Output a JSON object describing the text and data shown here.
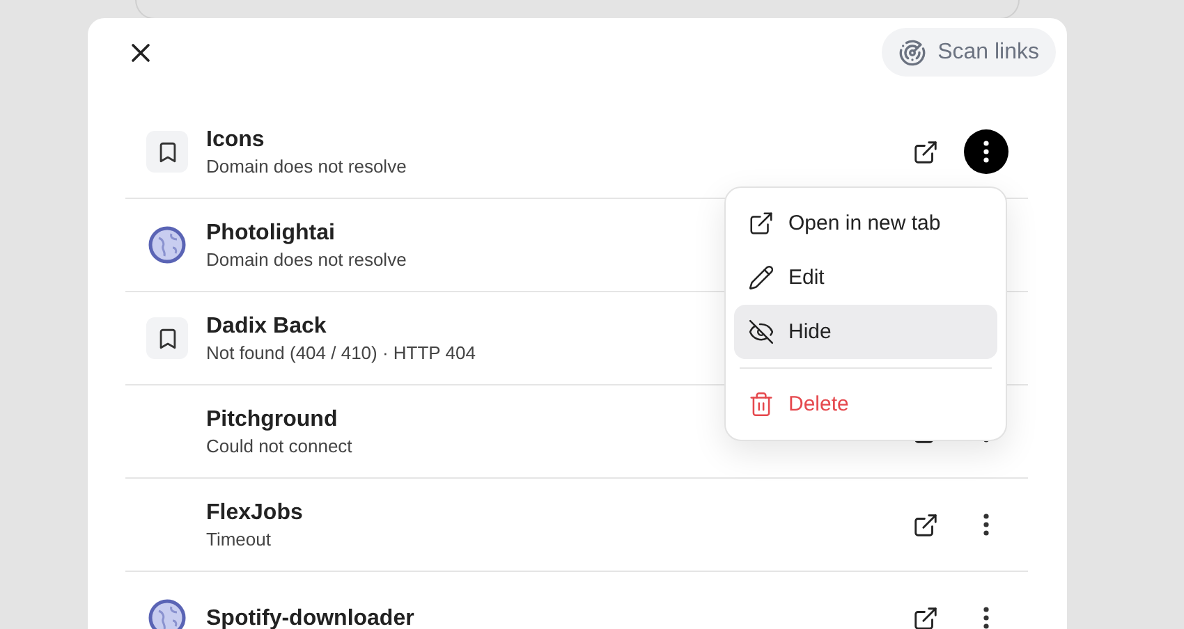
{
  "header": {
    "scan_button": "Scan links"
  },
  "links": [
    {
      "title": "Icons",
      "status": "Domain does not resolve",
      "kind": "bookmark",
      "menu_open": true
    },
    {
      "title": "Photolightai",
      "status": "Domain does not resolve",
      "kind": "globe",
      "menu_open": false
    },
    {
      "title": "Dadix Back",
      "status": "Not found (404 / 410) · HTTP 404",
      "kind": "bookmark",
      "menu_open": false
    },
    {
      "title": "Pitchground",
      "status": "Could not connect",
      "kind": "plain",
      "menu_open": false
    },
    {
      "title": "FlexJobs",
      "status": "Timeout",
      "kind": "plain",
      "menu_open": false
    },
    {
      "title": "Spotify-downloader",
      "kind": "globe",
      "menu_open": false
    }
  ],
  "menu": [
    {
      "label": "Open in new tab",
      "kind": "open",
      "selected": false
    },
    {
      "label": "Edit",
      "kind": "edit",
      "selected": false
    },
    {
      "label": "Hide",
      "kind": "hide",
      "selected": true
    },
    {
      "label": "Delete",
      "kind": "delete",
      "selected": false
    }
  ]
}
